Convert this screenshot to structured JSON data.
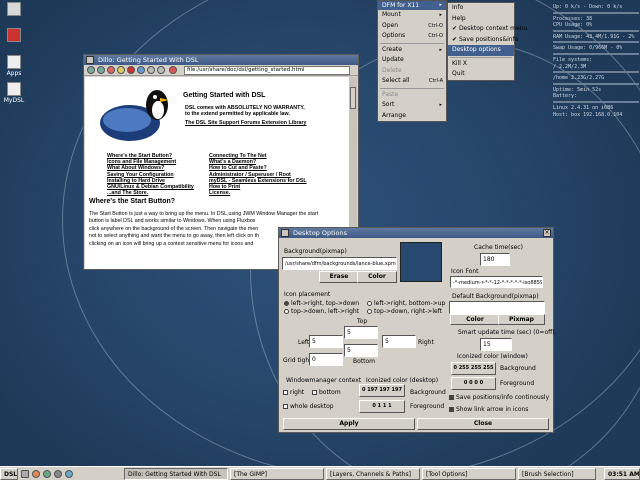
{
  "desktop": {
    "icons": [
      {
        "label": ""
      },
      {
        "label": ""
      },
      {
        "label": "Apps"
      },
      {
        "label": "MyDSL"
      }
    ]
  },
  "conky": {
    "rows": [
      "Up: 0 k/s - Down: 0 k/s",
      "",
      "Processes: 38",
      "CPU Usage: 0%",
      "",
      "RAM Usage: 43.4M/1.91G - 2%",
      "",
      "Swap Usage: 0/966M - 0%",
      "",
      "File systems:",
      "/ 2.2M/2.3M",
      "",
      "/home 2.23G/2.27G",
      "",
      "Uptime: 5min 52s",
      "Battery:",
      "",
      "Linux 2.4.31 on i686",
      "Host: box 192.168.0.104"
    ]
  },
  "dillo": {
    "title": "Dillo: Getting Started With DSL",
    "url": "file:/usr/share/doc/dsl/getting_started.html",
    "page": {
      "heading": "Getting Started with DSL",
      "intro1": "DSL comes with ABSOLUTELY NO WARRANTY,",
      "intro2": "to the extend permitted by applicable law.",
      "links_top": "The DSL Site  Support Forums Extension Library",
      "col1": [
        "Where's the Start Button?",
        "Icons and File Management",
        "What About Windows?",
        "Saving Your Configuration",
        "Installing to Hard Drive",
        "GNU/Linux & Debian Compatibility",
        "...and The Store."
      ],
      "col2": [
        "Connecting To The Net",
        "What's a Daemon?",
        "How to Cut and Paste?",
        "Administrator / Superuser / Root",
        "myDSL - Seamless Extensions for DSL",
        "How to Print",
        "License."
      ],
      "section": "Where's the Start Button?",
      "body": [
        "The Start Button is just a way to bring up the menu. In DSL,using JWM Window Manager the start",
        "button is label DSL and works similar to Windows. When using Fluxbox",
        "click anywhere on the background of the screen. Then navigate the men",
        "not to select anything and want the menu to go away, then left click on th",
        "clicking on an icon will bring up a context sensitive menu for icons and"
      ]
    }
  },
  "menu_main": {
    "header": "DFM for X11",
    "items": [
      {
        "label": "Mount",
        "arrow": true
      },
      {
        "label": "Open",
        "shortcut": "Ctrl-O"
      },
      {
        "label": "Options",
        "shortcut": "Ctrl-O"
      },
      {
        "sep": true
      },
      {
        "label": "Create",
        "arrow": true
      },
      {
        "label": "Update"
      },
      {
        "label": "Delete",
        "dim": true
      },
      {
        "label": "Select all",
        "shortcut": "Ctrl-A"
      },
      {
        "sep": true
      },
      {
        "label": "Paste",
        "dim": true
      },
      {
        "label": "Sort",
        "arrow": true
      },
      {
        "label": "Arrange"
      }
    ]
  },
  "menu_sub": {
    "items": [
      {
        "label": "Info"
      },
      {
        "label": "Help"
      },
      {
        "label": "Desktop context menu",
        "check": true
      },
      {
        "label": "Save positions&info",
        "check": true
      },
      {
        "label": "Desktop options",
        "sel": true
      },
      {
        "sep": true
      },
      {
        "label": "Kill X"
      },
      {
        "label": "Quit"
      }
    ]
  },
  "dialog": {
    "title": "Desktop Options",
    "background_label": "Background(pixmap)",
    "background_value": "/usr/share/dfm/backgrounds/lance-blue.xpm",
    "erase": "Erase",
    "color": "Color",
    "cache_label": "Cache time(sec)",
    "cache_value": "180",
    "icon_font_label": "Icon Font",
    "icon_font_value": "-*-medium-r-*-*-12-*-*-*-*-*-iso8859-1",
    "default_bg_label": "Default Background(pixmap)",
    "color2": "Color",
    "pixmap": "Pixmap",
    "smart_update_label": "Smart update time (sec) (0=off)",
    "smart_update_value": "15",
    "iconized_color_label": "Iconized color (window)",
    "iconized_bg_value": "0 255 255 255",
    "iconized_fg_value": "0 0 0 0",
    "background": "Background",
    "foreground": "Foreground",
    "icon_placement_label": "Icon placement",
    "placements": [
      "left->right, top->down",
      "left->right, bottom->up",
      "top->down, left->right",
      "top->down, right->left"
    ],
    "top_label": "Top",
    "top_value": "5",
    "left_label": "Left",
    "left_value": "5",
    "right_label": "Right",
    "right_value": "5",
    "bottom_label": "Bottom",
    "bottom_value": "5",
    "grid_label": "Grid tight",
    "grid_value": "0",
    "wm_context_label": "Windowmanager context",
    "right": "right",
    "bottom": "bottom",
    "whole_desktop": "whole desktop",
    "iconized_desk_label": "Iconized color (desktop)",
    "desk_bg_value": "0 197 197 197",
    "desk_fg_value": "0 1 1 1",
    "save_positions": "Save positions/info continously",
    "show_arrow": "Show link arrow in icons",
    "apply": "Apply",
    "close": "Close"
  },
  "taskbar": {
    "start": "DSL",
    "tasks": [
      "Dillo: Getting Started With DSL",
      "[The GIMP]",
      "[Layers, Channels & Paths]",
      "[Tool Options]",
      "[Brush Selection]"
    ],
    "clock": "03:51 AM"
  },
  "colors": {
    "desktop": "#27476b",
    "titlebar": "#4a6690",
    "selection": "#41608e",
    "panel": "#d4d0c8"
  }
}
